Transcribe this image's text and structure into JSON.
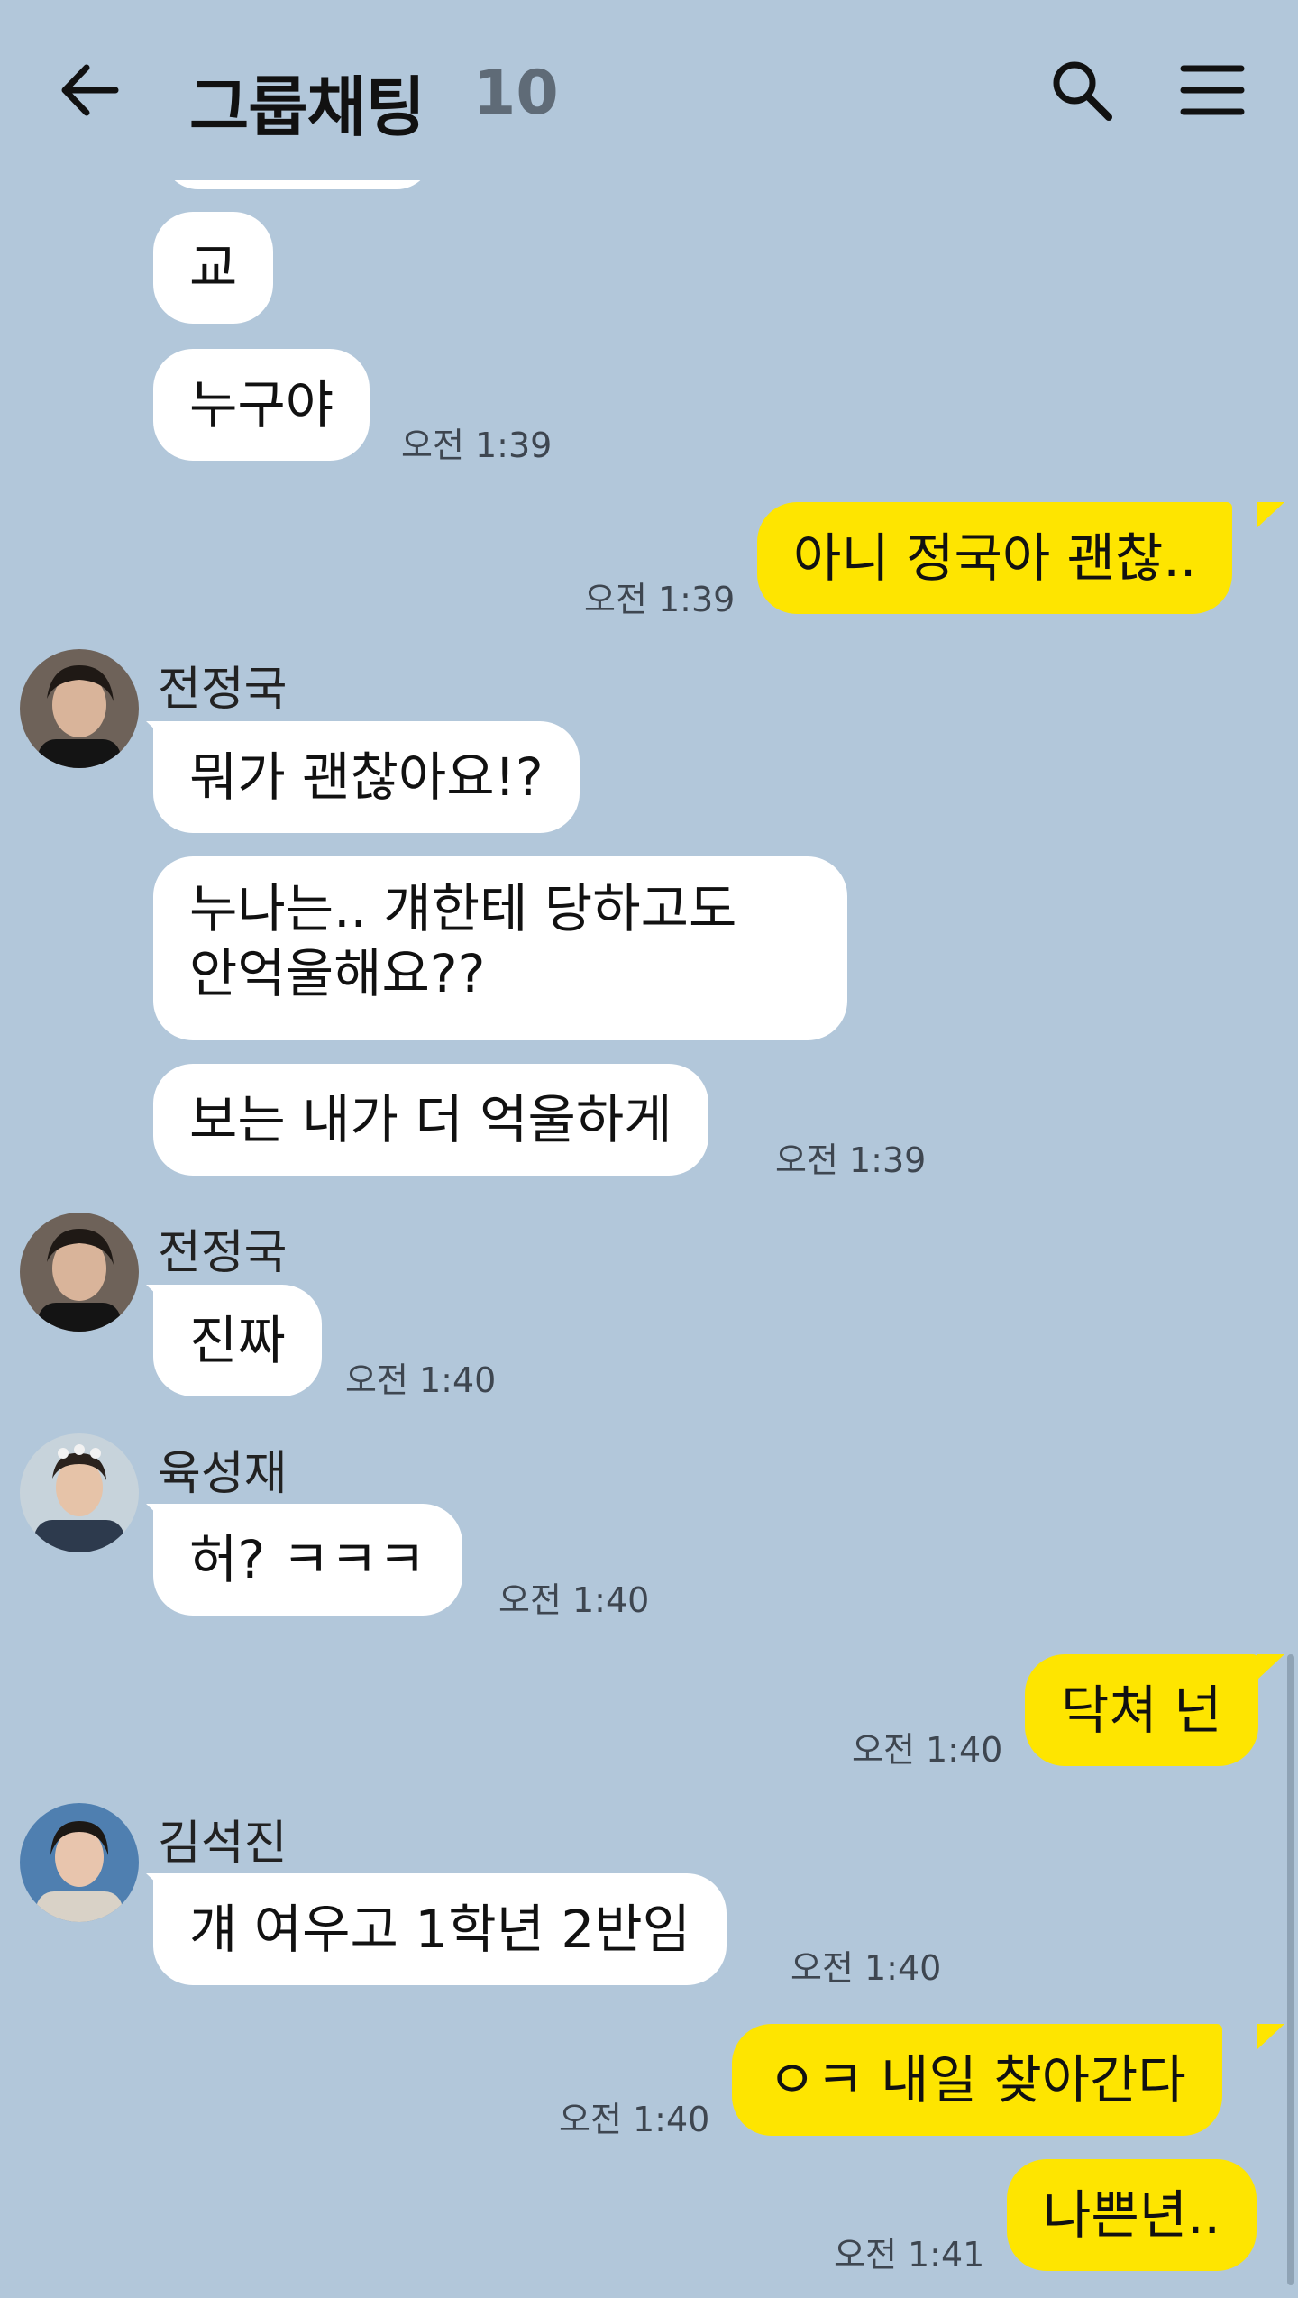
{
  "header": {
    "title": "그룹채팅",
    "member_count": "10"
  },
  "messages": {
    "m1": {
      "text": "교"
    },
    "m2": {
      "text": "누구야",
      "time": "오전 1:39"
    },
    "m3": {
      "text": "아니 정국아 괜찮..",
      "time": "오전 1:39"
    },
    "m4": {
      "sender": "전정국",
      "text": "뭐가 괜찮아요!?"
    },
    "m5": {
      "text_line1": "누나는.. 걔한테 당하고도",
      "text_line2": "안억울해요??"
    },
    "m6": {
      "text": "보는 내가 더 억울하게",
      "time": "오전 1:39"
    },
    "m7": {
      "sender": "전정국",
      "text": "진짜",
      "time": "오전 1:40"
    },
    "m8": {
      "sender": "육성재",
      "text": "허? ㅋㅋㅋ",
      "time": "오전 1:40"
    },
    "m9": {
      "text": "닥쳐 넌",
      "time": "오전 1:40"
    },
    "m10": {
      "sender": "김석진",
      "text": "걔 여우고 1학년 2반임",
      "time": "오전 1:40"
    },
    "m11": {
      "text": "ㅇㅋ 내일 찾아간다",
      "time": "오전 1:40"
    },
    "m12": {
      "text": "나쁜년..",
      "time": "오전 1:41"
    }
  },
  "icons": {
    "back": "arrow-left-icon",
    "search": "search-icon",
    "menu": "hamburger-menu-icon"
  },
  "colors": {
    "background": "#b2c7da",
    "incoming_bubble": "#ffffff",
    "outgoing_bubble": "#fee500"
  }
}
